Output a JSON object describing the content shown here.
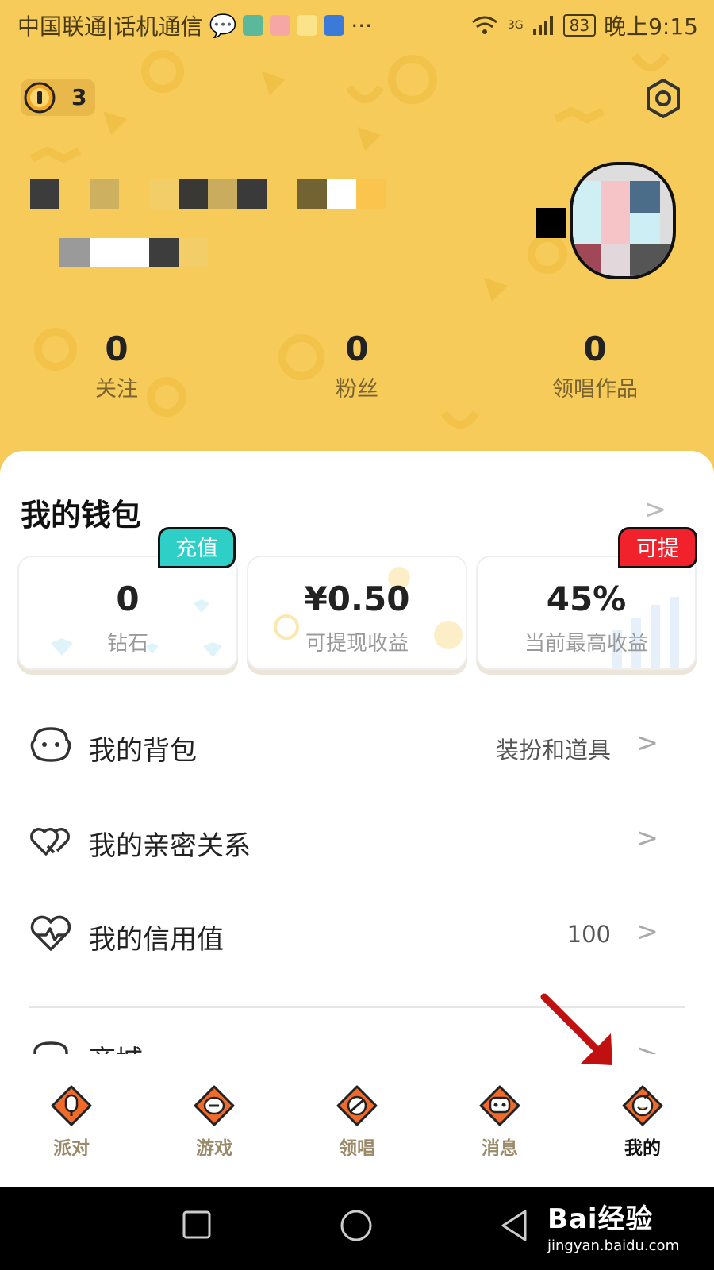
{
  "status_bar": {
    "carrier": "中国联通|话机通信",
    "battery": "83",
    "time": "晚上9:15",
    "signal": "3G",
    "icons": [
      "chat-bubble-icon",
      "app-icon",
      "app-icon",
      "app-icon",
      "bulb-icon",
      "more-icon",
      "wifi-icon",
      "signal-icon"
    ]
  },
  "header": {
    "coin_count": "3",
    "stats": [
      {
        "value": "0",
        "label": "关注"
      },
      {
        "value": "0",
        "label": "粉丝"
      },
      {
        "value": "0",
        "label": "领唱作品"
      }
    ]
  },
  "wallet": {
    "title": "我的钱包",
    "cards": [
      {
        "value": "0",
        "label": "钻石",
        "badge": "充值"
      },
      {
        "value": "¥0.50",
        "label": "可提现收益"
      },
      {
        "value": "45%",
        "label": "当前最高收益",
        "badge": "可提升"
      }
    ]
  },
  "menu": [
    {
      "label": "我的背包",
      "value": "装扮和道具",
      "icon": "backpack-icon"
    },
    {
      "label": "我的亲密关系",
      "value": "",
      "icon": "hearts-icon"
    },
    {
      "label": "我的信用值",
      "value": "100",
      "icon": "heart-pulse-icon"
    },
    {
      "label": "商城",
      "value": "",
      "icon": "shop-icon"
    }
  ],
  "bottom_nav": [
    {
      "label": "派对",
      "icon": "microphone-icon"
    },
    {
      "label": "游戏",
      "icon": "game-icon"
    },
    {
      "label": "领唱",
      "icon": "planet-icon"
    },
    {
      "label": "消息",
      "icon": "message-icon"
    },
    {
      "label": "我的",
      "icon": "profile-icon",
      "active": true
    }
  ],
  "watermark": {
    "main": "Bai经验",
    "sub": "jingyan.baidu.com"
  },
  "colors": {
    "header_bg": "#f7cb5a",
    "badge_teal": "#2ecfc6",
    "badge_red": "#f1222c",
    "annotation_arrow": "#c01010"
  }
}
